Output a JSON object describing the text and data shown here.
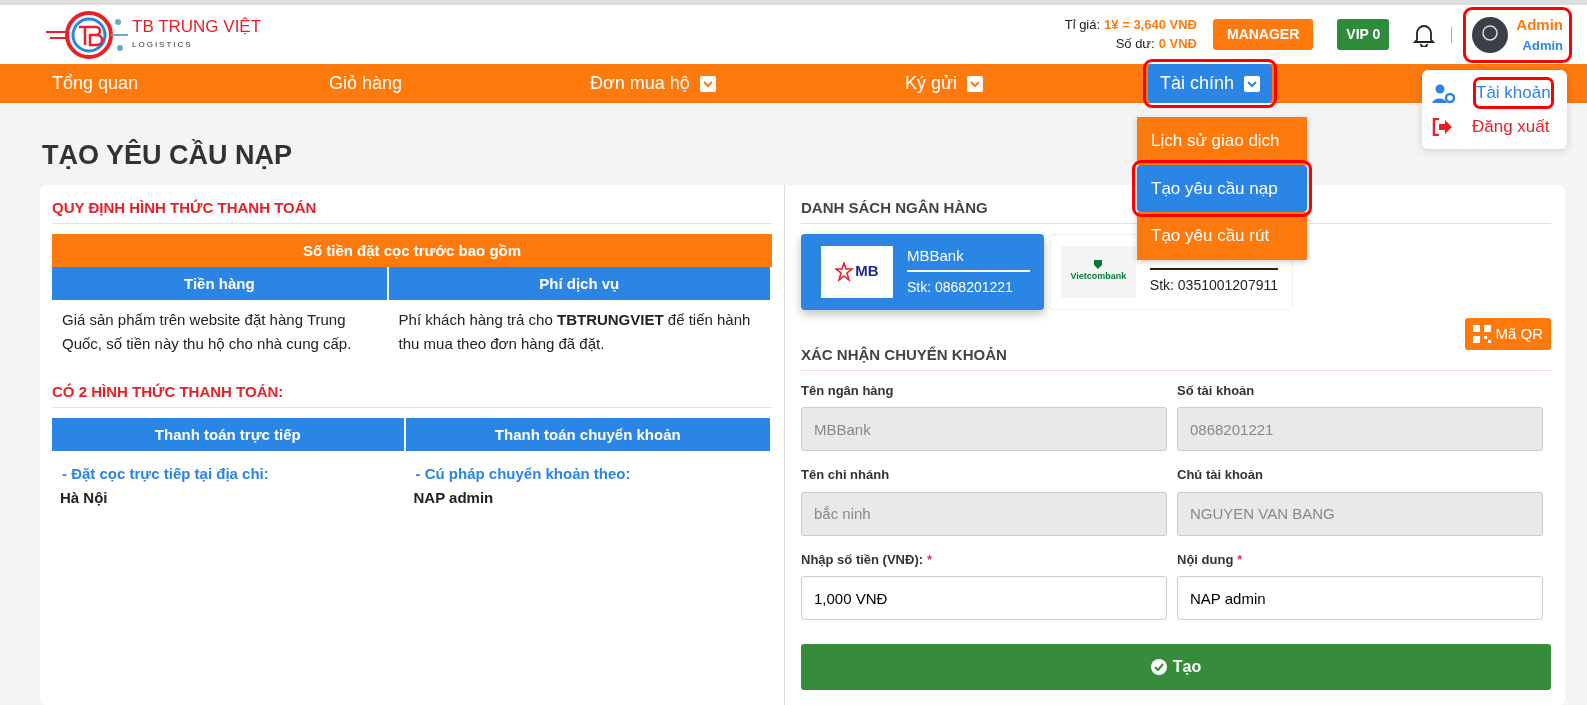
{
  "header": {
    "brand": {
      "name": "TB TRUNG VIỆT",
      "tagline": "LOGISTICS"
    },
    "rate_label": "Tỉ giá:",
    "rate_value": "1¥ = 3,640 VNĐ",
    "balance_label": "Số dư:",
    "balance_value": "0 VNĐ",
    "role_button": "MANAGER",
    "vip_badge": "VIP 0",
    "user": {
      "name": "Admin",
      "role": "Admin",
      "annotated": true
    }
  },
  "nav": [
    {
      "label": "Tổng quan",
      "dropdown": false,
      "selected": false,
      "annotated": false
    },
    {
      "label": "Giỏ hàng",
      "dropdown": false,
      "selected": false,
      "annotated": false
    },
    {
      "label": "Đơn mua hộ",
      "dropdown": true,
      "selected": false,
      "annotated": false
    },
    {
      "label": "Ký gửi",
      "dropdown": true,
      "selected": false,
      "annotated": false
    },
    {
      "label": "Tài chính",
      "dropdown": true,
      "selected": true,
      "annotated": true
    }
  ],
  "finance_menu": [
    {
      "label": "Lịch sử giao dịch",
      "selected": false,
      "annotated": false
    },
    {
      "label": "Tạo yêu cầu nạp",
      "selected": true,
      "annotated": true
    },
    {
      "label": "Tạo yêu cầu rút",
      "selected": false,
      "annotated": false
    }
  ],
  "account_menu": [
    {
      "kind": "account",
      "label": "Tài khoản",
      "annotated": true
    },
    {
      "kind": "logout",
      "label": "Đăng xuất",
      "annotated": false
    }
  ],
  "page_title": "TẠO YÊU CẦU NẠP",
  "rules": {
    "title": "QUY ĐỊNH HÌNH THỨC THANH TOÁN",
    "deposit_header": "Số tiền đặt cọc trước bao gồm",
    "columns": [
      "Tiền hàng",
      "Phí dịch vụ"
    ],
    "cells": [
      "Giá sản phẩm trên website đặt hàng Trung Quốc, số tiền này thu hộ cho nhà cung cấp.",
      "Phí khách hàng trả cho **TBTRUNGVIET** để tiến hành thu mua theo đơn hàng đã đặt."
    ],
    "methods_title": "CÓ 2 HÌNH THỨC THANH TOÁN:",
    "methods": [
      {
        "name": "Thanh toán trực tiếp",
        "note": "- Đặt cọc trực tiếp tại địa chỉ:",
        "value": "Hà Nội"
      },
      {
        "name": "Thanh toán chuyển khoản",
        "note": "- Cú pháp chuyển khoản theo:",
        "value": "NAP admin"
      }
    ]
  },
  "banks": {
    "title": "DANH SÁCH NGÂN HÀNG",
    "items": [
      {
        "kind": "mb",
        "logo_text": "MB",
        "name": "MBBank",
        "account": "Stk: 0868201221",
        "selected": true
      },
      {
        "kind": "vcb",
        "logo_text": "Vietcombank",
        "account": "Stk: 0351001207911",
        "selected": false
      }
    ]
  },
  "qr_button": "Mã QR",
  "transfer": {
    "title": "XÁC NHẬN CHUYỂN KHOẢN",
    "required_mark": "*",
    "fields": [
      {
        "label": "Tên ngân hàng",
        "value": "MBBank",
        "required": false,
        "disabled": true
      },
      {
        "label": "Số tài khoản",
        "value": "0868201221",
        "required": false,
        "disabled": true
      },
      {
        "label": "Tên chi nhánh",
        "value": "bắc ninh",
        "required": false,
        "disabled": true
      },
      {
        "label": "Chủ tài khoản",
        "value": "NGUYEN VAN BANG",
        "required": false,
        "disabled": true
      },
      {
        "label": "Nhập số tiền (VNĐ):",
        "value": "1,000 VNĐ",
        "required": true,
        "disabled": false
      },
      {
        "label": "Nội dung",
        "value": "NAP admin",
        "required": true,
        "disabled": false
      }
    ],
    "submit": "Tạo"
  }
}
